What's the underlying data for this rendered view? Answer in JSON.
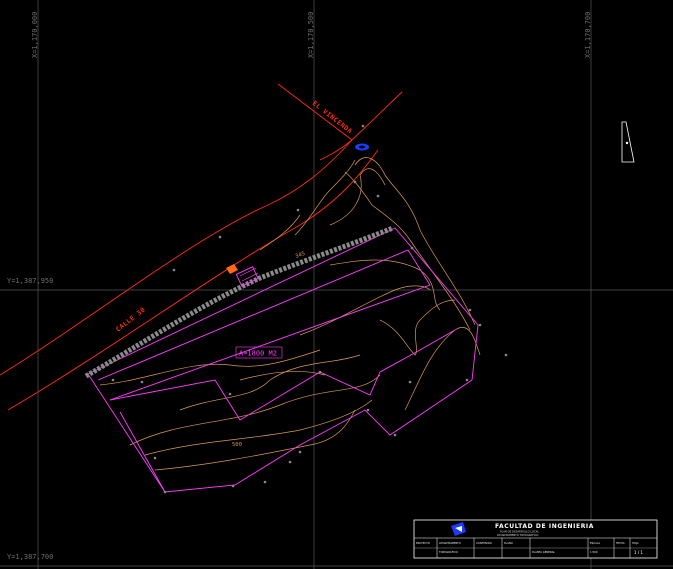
{
  "grid": {
    "x_labels": [
      "X=1,170,000",
      "X=1,170,500",
      "X=1,170,700"
    ],
    "y_labels": [
      "Y=1,387,950",
      "Y=1,387,700"
    ]
  },
  "roads": {
    "calle": "CALLE 30",
    "via": "EL VINCENDA"
  },
  "lot": {
    "area": "A=1800 M2"
  },
  "contours": {
    "label_1": "500",
    "label_2": "345"
  },
  "title_block": {
    "title": "FACULTAD DE INGENIERIA",
    "subtitle_1": "PLAN DE DESARROLLO LOCAL",
    "subtitle_2": "LEVANTAMIENTO TOPOGRAFICO",
    "cells": [
      "",
      "PROYECTO",
      "LEVANTAMIENTO",
      "CONTENIDO",
      "PLANO",
      "ESCALA",
      "FECHA",
      "HOJA",
      "",
      "TOPOGRAFICO",
      "",
      "PLANTA GENERAL",
      "1:500",
      "",
      "1/1"
    ],
    "sheet": "1 / 1"
  },
  "colors": {
    "grid": "#555555",
    "road": "#ff2a1a",
    "lot": "#ff3cff",
    "contour": "#d99a56",
    "access": "#8a8a8a",
    "marker": "#1a3cff"
  },
  "icons": {
    "north_arrow": "north-arrow-icon",
    "logo": "university-logo-icon"
  }
}
